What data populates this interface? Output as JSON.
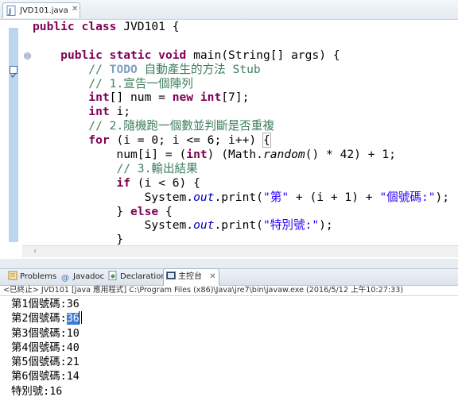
{
  "editor": {
    "tab_label": "JVD101.java",
    "tab_close": "✕",
    "fold_symbol": "⊖",
    "lines": [
      [
        {
          "t": "public class ",
          "c": "kw"
        },
        {
          "t": "JVD101 {",
          "c": ""
        }
      ],
      [
        {
          "t": "",
          "c": ""
        }
      ],
      [
        {
          "t": "    ",
          "c": ""
        },
        {
          "t": "public static void ",
          "c": "kw"
        },
        {
          "t": "main(String[] args) {",
          "c": ""
        }
      ],
      [
        {
          "t": "        ",
          "c": ""
        },
        {
          "t": "// ",
          "c": "cm"
        },
        {
          "t": "TODO",
          "c": "todo"
        },
        {
          "t": " 自動產生的方法 Stub",
          "c": "cm"
        }
      ],
      [
        {
          "t": "        ",
          "c": ""
        },
        {
          "t": "// 1.宣告一個陣列",
          "c": "cm"
        }
      ],
      [
        {
          "t": "        ",
          "c": ""
        },
        {
          "t": "int",
          "c": "kw"
        },
        {
          "t": "[] num = ",
          "c": ""
        },
        {
          "t": "new int",
          "c": "kw"
        },
        {
          "t": "[7];",
          "c": ""
        }
      ],
      [
        {
          "t": "        ",
          "c": ""
        },
        {
          "t": "int",
          "c": "kw"
        },
        {
          "t": " i;",
          "c": ""
        }
      ],
      [
        {
          "t": "        ",
          "c": ""
        },
        {
          "t": "// 2.隨機跑一個數並判斷是否重複",
          "c": "cm"
        }
      ],
      [
        {
          "t": "        ",
          "c": ""
        },
        {
          "t": "for",
          "c": "kw"
        },
        {
          "t": " (i = 0; i <= 6; i++) ",
          "c": ""
        },
        {
          "t": "{",
          "c": "brace-box"
        }
      ],
      [
        {
          "t": "            num[i] = (",
          "c": ""
        },
        {
          "t": "int",
          "c": "kw"
        },
        {
          "t": ") (Math.",
          "c": ""
        },
        {
          "t": "random",
          "c": "ital"
        },
        {
          "t": "() * 42) + 1;",
          "c": ""
        }
      ],
      [
        {
          "t": "            ",
          "c": ""
        },
        {
          "t": "// 3.輸出結果",
          "c": "cm"
        }
      ],
      [
        {
          "t": "            ",
          "c": ""
        },
        {
          "t": "if",
          "c": "kw"
        },
        {
          "t": " (i < 6) {",
          "c": ""
        }
      ],
      [
        {
          "t": "                System.",
          "c": ""
        },
        {
          "t": "out",
          "c": "fld"
        },
        {
          "t": ".print(",
          "c": ""
        },
        {
          "t": "\"第\"",
          "c": "str"
        },
        {
          "t": " + (i + 1) + ",
          "c": ""
        },
        {
          "t": "\"個號碼:\"",
          "c": "str"
        },
        {
          "t": ");",
          "c": ""
        }
      ],
      [
        {
          "t": "            } ",
          "c": ""
        },
        {
          "t": "else",
          "c": "kw"
        },
        {
          "t": " {",
          "c": ""
        }
      ],
      [
        {
          "t": "                System.",
          "c": ""
        },
        {
          "t": "out",
          "c": "fld"
        },
        {
          "t": ".print(",
          "c": ""
        },
        {
          "t": "\"特別號:\"",
          "c": "str"
        },
        {
          "t": ");",
          "c": ""
        }
      ],
      [
        {
          "t": "            }",
          "c": ""
        }
      ]
    ]
  },
  "console_view": {
    "tabs": [
      {
        "label": "Problems",
        "icon": "problems-icon"
      },
      {
        "label": "Javadoc",
        "icon": "javadoc-icon"
      },
      {
        "label": "Declaration",
        "icon": "declaration-icon"
      },
      {
        "label": "主控台",
        "icon": "console-icon",
        "active": true
      }
    ],
    "tab_close": "✕",
    "status": "<已終止> JVD101 [Java 應用程式] C:\\Program Files (x86)\\Java\\jre7\\bin\\javaw.exe (2016/5/12 上午10:27:33)",
    "output": [
      {
        "label": "第1個號碼:",
        "value": "36"
      },
      {
        "label": "第2個號碼:",
        "value": "36",
        "selected": true
      },
      {
        "label": "第3個號碼:",
        "value": "10"
      },
      {
        "label": "第4個號碼:",
        "value": "40"
      },
      {
        "label": "第5個號碼:",
        "value": "21"
      },
      {
        "label": "第6個號碼:",
        "value": "14"
      },
      {
        "label": "特別號:",
        "value": "16"
      }
    ]
  },
  "colors": {
    "keyword": "#7f0055",
    "comment": "#3f7f5f",
    "string": "#2a00ff",
    "field": "#0000c0",
    "selection": "#3a7dd6"
  }
}
